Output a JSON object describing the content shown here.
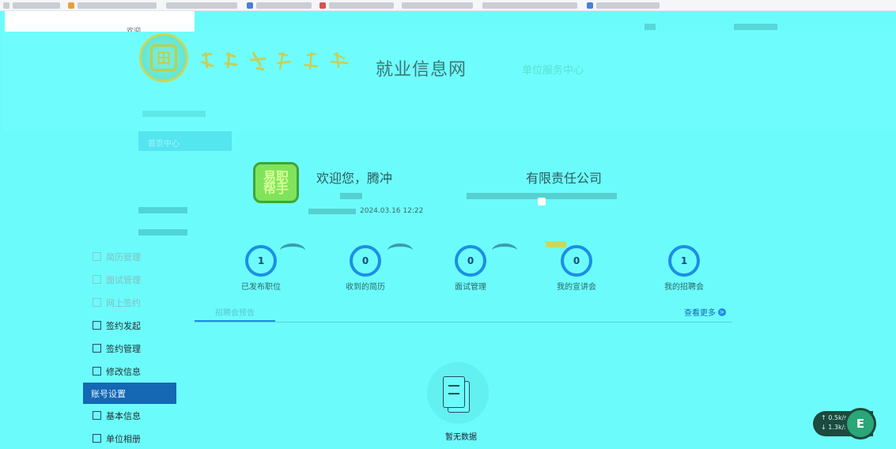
{
  "header": {
    "welcome_top": "欢迎",
    "site_title": "就业信息网",
    "center_title": "单位服务中心",
    "nav_tab": "首页中心"
  },
  "profile": {
    "avatar_text": "易职\n帮手",
    "welcome": "欢迎您，腾冲",
    "company": "有限责任公司",
    "login_time": "2024.03.16 12:22"
  },
  "stats": [
    {
      "value": "1",
      "label": "已发布职位"
    },
    {
      "value": "0",
      "label": "收到的简历"
    },
    {
      "value": "0",
      "label": "面试管理"
    },
    {
      "value": "0",
      "label": "我的宣讲会"
    },
    {
      "value": "1",
      "label": "我的招聘会"
    }
  ],
  "sidebar": {
    "faded_items": [
      "简历管理",
      "面试管理",
      "网上签约"
    ],
    "items": [
      "签约发起",
      "签约管理",
      "修改信息"
    ],
    "section_head": "账号设置",
    "account_items": [
      "基本信息",
      "单位相册"
    ]
  },
  "tabs": {
    "active": "招聘会预告",
    "more": "查看更多"
  },
  "empty": {
    "text": "暂无数据"
  },
  "speed": {
    "up": "0.5k/s",
    "down": "1.3k/s",
    "ball": "E"
  }
}
